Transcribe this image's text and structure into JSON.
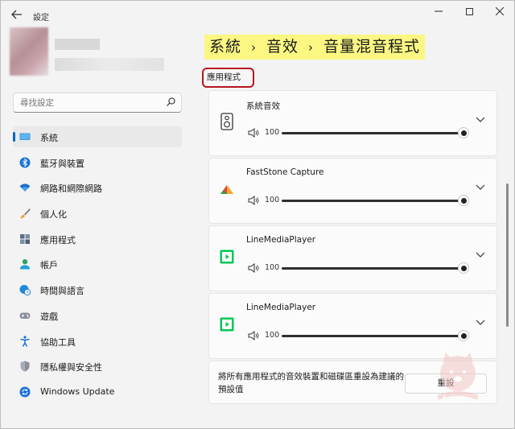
{
  "window": {
    "title": "設定",
    "back_icon": "arrow-left-icon",
    "controls": [
      "minimize-icon",
      "maximize-icon",
      "close-icon"
    ]
  },
  "search": {
    "placeholder": "尋找設定",
    "value": ""
  },
  "sidebar": {
    "items": [
      {
        "label": "系統",
        "icon": "monitor-icon",
        "active": true
      },
      {
        "label": "藍牙與裝置",
        "icon": "bluetooth-icon",
        "active": false
      },
      {
        "label": "網路和網際網路",
        "icon": "wifi-icon",
        "active": false
      },
      {
        "label": "個人化",
        "icon": "brush-icon",
        "active": false
      },
      {
        "label": "應用程式",
        "icon": "apps-icon",
        "active": false
      },
      {
        "label": "帳戶",
        "icon": "person-icon",
        "active": false
      },
      {
        "label": "時間與語言",
        "icon": "globe-clock-icon",
        "active": false
      },
      {
        "label": "遊戲",
        "icon": "gamepad-icon",
        "active": false
      },
      {
        "label": "協助工具",
        "icon": "accessibility-icon",
        "active": false
      },
      {
        "label": "隱私權與安全性",
        "icon": "shield-icon",
        "active": false
      },
      {
        "label": "Windows Update",
        "icon": "windows-update-icon",
        "active": false
      }
    ]
  },
  "breadcrumb": {
    "items": [
      "系統",
      "音效",
      "音量混音程式"
    ],
    "separator": "›"
  },
  "section": {
    "label": "應用程式"
  },
  "apps": [
    {
      "name": "系統音效",
      "icon": "speaker-icon",
      "volume": 100
    },
    {
      "name": "FastStone Capture",
      "icon": "faststone-capture-icon",
      "volume": 100
    },
    {
      "name": "LineMediaPlayer",
      "icon": "line-media-player-icon",
      "volume": 100
    },
    {
      "name": "LineMediaPlayer",
      "icon": "line-media-player-icon",
      "volume": 100
    }
  ],
  "reset": {
    "description": "將所有應用程式的音效裝置和磁碟區重設為建議的預設值",
    "button_label": "重設"
  },
  "colors": {
    "accent": "#0067c0",
    "highlight": "#fbf782",
    "callout_border": "#b8141e",
    "line_green": "#06c755"
  }
}
